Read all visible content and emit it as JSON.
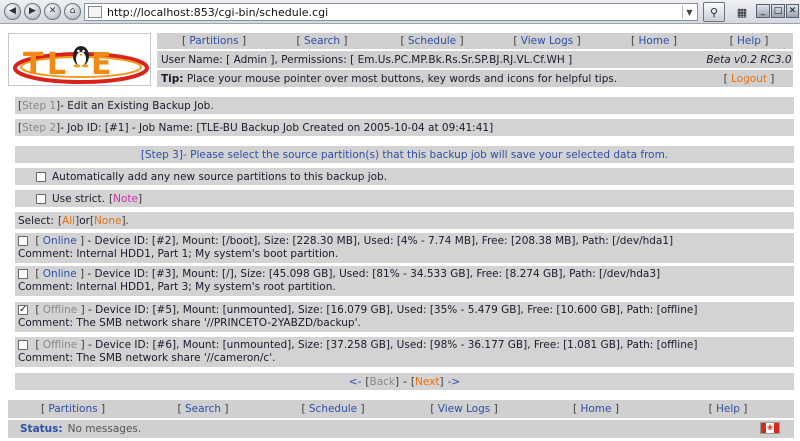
{
  "browser": {
    "url": "http://localhost:853/cgi-bin/schedule.cgi"
  },
  "logo": {
    "text": "TLE"
  },
  "nav": [
    {
      "label": "Partitions"
    },
    {
      "label": "Search"
    },
    {
      "label": "Schedule"
    },
    {
      "label": "View Logs"
    },
    {
      "label": "Home"
    },
    {
      "label": "Help"
    }
  ],
  "header": {
    "user_label": "User Name:",
    "user_value": "Admin",
    "perm_label": ", Permissions:",
    "perm_value": "Em.Us.PC.MP.Bk.Rs.Sr.SP.BJ.RJ.VL.Cf.WH",
    "version": "Beta v0.2 RC3.0",
    "tip_label": "Tip:",
    "tip_text": "Place your mouse pointer over most buttons, key words and icons for helpful tips.",
    "logout": "Logout"
  },
  "steps": {
    "step1_label": "Step 1",
    "step1_text": " - Edit an Existing Backup Job.",
    "step2_label": "Step 2",
    "step2_text": " - Job ID: [#1] - Job Name: [TLE-BU Backup Job Created on 2005-10-04 at 09:41:41]",
    "step3_label": "Step 3",
    "step3_text": " - Please select the source partition(s) that this backup job will save your selected data from."
  },
  "options": {
    "auto_add": "Automatically add any new source partitions to this backup job.",
    "strict": "Use strict.",
    "note": "Note",
    "select_label": "Select:",
    "all": "All",
    "or": " or ",
    "none": "None"
  },
  "partitions": [
    {
      "checked": false,
      "state": "Online",
      "rest": " - Device ID: [#2], Mount: [/boot], Size: [228.30 MB], Used: [4% - 7.74 MB], Free: [208.38 MB], Path: [/dev/hda1]",
      "comment": "Comment: Internal HDD1, Part 1; My system's boot partition."
    },
    {
      "checked": false,
      "state": "Online",
      "rest": " - Device ID: [#3], Mount: [/], Size: [45.098 GB], Used: [81% - 34.533 GB], Free: [8.274 GB], Path: [/dev/hda3]",
      "comment": "Comment: Internal HDD1, Part 3; My system's root partition."
    },
    {
      "checked": true,
      "state": "Offline",
      "rest": " - Device ID: [#5], Mount: [unmounted], Size: [16.079 GB], Used: [35% - 5.479 GB], Free: [10.600 GB], Path: [offline]",
      "comment": "Comment: The SMB network share '//PRINCETO-2YABZD/backup'."
    },
    {
      "checked": false,
      "state": "Offline",
      "rest": " - Device ID: [#6], Mount: [unmounted], Size: [37.258 GB], Used: [98% - 36.177 GB], Free: [1.081 GB], Path: [offline]",
      "comment": "Comment: The SMB network share '//cameron/c'."
    }
  ],
  "pager": {
    "prev_arrow": "<-",
    "back": "Back",
    "next": "Next",
    "next_arrow": "->"
  },
  "status": {
    "label": "Status:",
    "text": "No messages."
  },
  "colors": {
    "link": "#2e4fa8",
    "accent": "#e8700f",
    "note": "#cc33aa",
    "band": "#d3d3d3",
    "logo_red": "#d8231a",
    "logo_orange": "#f29a1c"
  }
}
